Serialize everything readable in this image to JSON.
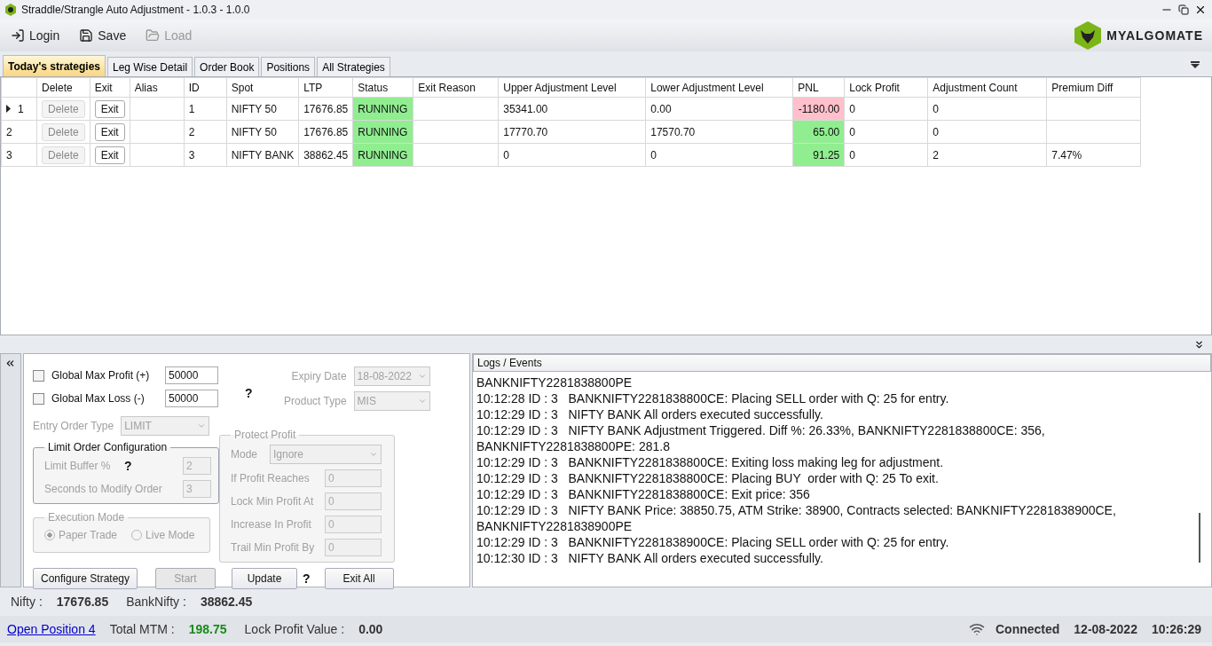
{
  "window": {
    "title": "Straddle/Strangle Auto Adjustment - 1.0.3 - 1.0.0"
  },
  "toolbar": [
    {
      "label": "Login",
      "kind": "login",
      "disabled": false
    },
    {
      "label": "Save",
      "kind": "save",
      "disabled": false
    },
    {
      "label": "Load",
      "kind": "load",
      "disabled": true
    }
  ],
  "logo": {
    "text": "MYALGOMATE"
  },
  "tabs": [
    {
      "label": "Today's strategies",
      "selected": true
    },
    {
      "label": "Leg Wise Detail",
      "selected": false
    },
    {
      "label": "Order Book",
      "selected": false
    },
    {
      "label": "Positions",
      "selected": false
    },
    {
      "label": "All Strategies",
      "selected": false
    }
  ],
  "table": {
    "columns": [
      "Delete",
      "Exit",
      "Alias",
      "ID",
      "Spot",
      "LTP",
      "Status",
      "Exit Reason",
      "Upper Adjustment  Level",
      "Lower Adjustment  Level",
      "PNL",
      "Lock Profit",
      "Adjustment Count",
      "Premium Diff"
    ],
    "rows": [
      {
        "number": "1",
        "current": true,
        "delete": "Delete",
        "exit": "Exit",
        "alias": "",
        "id": "1",
        "spot": "NIFTY 50",
        "ltp": "17676.85",
        "status": "RUNNING",
        "exit_reason": "",
        "upper": "35341.00",
        "lower": "0.00",
        "pnl": "-1180.00",
        "color": "#ffc0cb",
        "lock_profit": "0",
        "adjustment_count": "0",
        "premium_diff": ""
      },
      {
        "number": "2",
        "current": false,
        "delete": "Delete",
        "exit": "Exit",
        "alias": "",
        "id": "2",
        "spot": "NIFTY 50",
        "ltp": "17676.85",
        "status": "RUNNING",
        "exit_reason": "",
        "upper": "17770.70",
        "lower": "17570.70",
        "pnl": "65.00",
        "color": "#90ee90",
        "lock_profit": "0",
        "adjustment_count": "0",
        "premium_diff": ""
      },
      {
        "number": "3",
        "current": false,
        "delete": "Delete",
        "exit": "Exit",
        "alias": "",
        "id": "3",
        "spot": "NIFTY BANK",
        "ltp": "38862.45",
        "status": "RUNNING",
        "exit_reason": "",
        "upper": "0",
        "lower": "0",
        "pnl": "91.25",
        "color": "#90ee90",
        "lock_profit": "0",
        "adjustment_count": "2",
        "premium_diff": "7.47%"
      }
    ]
  },
  "settings": {
    "max_profit": {
      "label": "Global Max Profit (+)",
      "checked": false,
      "value": "50000"
    },
    "max_loss": {
      "label": "Global Max Loss (-)",
      "checked": false,
      "value": "50000"
    },
    "help": "?",
    "expiry_date": {
      "label": "Expiry Date",
      "value": "18-08-2022"
    },
    "product_type": {
      "label": "Product Type",
      "value": "MIS"
    },
    "entry_order_type": {
      "label": "Entry Order Type",
      "value": "LIMIT"
    },
    "limit_order": {
      "title": "Limit Order Configuration",
      "buffer_label": "Limit Buffer %",
      "buffer_help": "?",
      "buffer": "2",
      "seconds_label": "Seconds to Modify Order",
      "seconds": "3"
    },
    "execution_mode": {
      "title": "Execution Mode",
      "options": [
        {
          "label": "Paper Trade",
          "selected": true
        },
        {
          "label": "Live Mode",
          "selected": false
        }
      ]
    },
    "protect_profit": {
      "title": "Protect Profit",
      "disabled": true,
      "mode_label": "Mode",
      "mode": "Ignore",
      "fields": [
        {
          "label": "If Profit Reaches",
          "value": "0"
        },
        {
          "label": "Lock Min Profit At",
          "value": "0"
        },
        {
          "label": "Increase In Profit",
          "value": "0"
        },
        {
          "label": "Trail Min Profit By",
          "value": "0"
        }
      ]
    },
    "buttons": [
      {
        "label": "Configure Strategy",
        "disabled": false
      },
      {
        "label": "Start",
        "disabled": true
      },
      {
        "label": "Update",
        "disabled": false,
        "help": "?"
      },
      {
        "label": "Exit All",
        "disabled": false
      }
    ]
  },
  "logs": {
    "title": "Logs / Events",
    "lines": [
      "BANKNIFTY2281838800PE",
      "10:12:28 ID : 3   BANKNIFTY2281838800CE: Placing SELL order with Q: 25 for entry.",
      "10:12:29 ID : 3   NIFTY BANK All orders executed successfully.",
      "10:12:29 ID : 3   NIFTY BANK Adjustment Triggered. Diff %: 26.33%, BANKNIFTY2281838800CE: 356,",
      "BANKNIFTY2281838800PE: 281.8",
      "10:12:29 ID : 3   BANKNIFTY2281838800CE: Exiting loss making leg for adjustment.",
      "10:12:29 ID : 3   BANKNIFTY2281838800CE: Placing BUY  order with Q: 25 To exit.",
      "10:12:29 ID : 3   BANKNIFTY2281838800CE: Exit price: 356",
      "10:12:29 ID : 3   NIFTY BANK Price: 38850.75, ATM Strike: 38900, Contracts selected: BANKNIFTY2281838900CE,",
      "BANKNIFTY2281838900PE",
      "10:12:29 ID : 3   BANKNIFTY2281838900CE: Placing SELL order with Q: 25 for entry.",
      "10:12:30 ID : 3   NIFTY BANK All orders executed successfully."
    ]
  },
  "index_bar": [
    {
      "label": "Nifty :",
      "value": "17676.85"
    },
    {
      "label": "BankNifty :",
      "value": "38862.45"
    }
  ],
  "status_bar": {
    "link": "Open Position 4",
    "mtm_label": "Total MTM :",
    "mtm": "198.75",
    "lock_label": "Lock Profit Value :",
    "lock": "0.00",
    "connection": "Connected",
    "date": "12-08-2022",
    "time": "10:26:29"
  }
}
